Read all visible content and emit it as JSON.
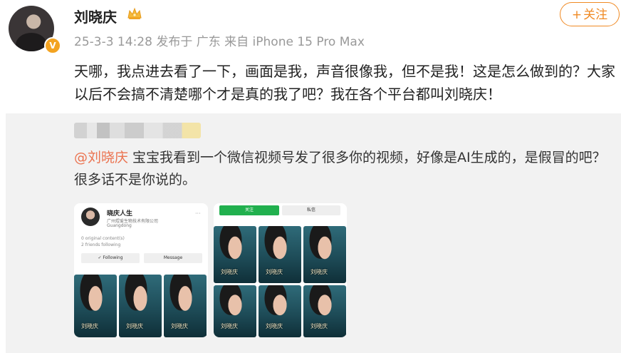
{
  "post": {
    "author": "刘晓庆",
    "meta": "25-3-3 14:28 发布于 广东 来自 iPhone 15 Pro Max",
    "follow_label": "关注",
    "follow_plus": "+",
    "badge": "V",
    "text": "天哪，我点进去看了一下，画面是我，声音很像我，但不是我！这是怎么做到的？大家以后不会搞不清楚哪个才是真的我了吧？我在各个平台都叫刘晓庆！"
  },
  "repost": {
    "mention": "@刘晓庆",
    "text": " 宝宝我看到一个微信视频号发了很多你的视频，好像是AI生成的，是假冒的吧？很多话不是你说的。"
  },
  "card1": {
    "name": "晓庆人生",
    "sub": "广州煜爱生物技术有限公司",
    "location": "Guangdong",
    "line1": "0 original content(s)",
    "line2": "2 friends following",
    "btn_following": "✓ Following",
    "btn_message": "Message",
    "dots": "···",
    "caption": "刘晓庆"
  },
  "card2": {
    "tab_follow": "关注",
    "tab_message": "私信",
    "caption": "刘晓庆"
  }
}
